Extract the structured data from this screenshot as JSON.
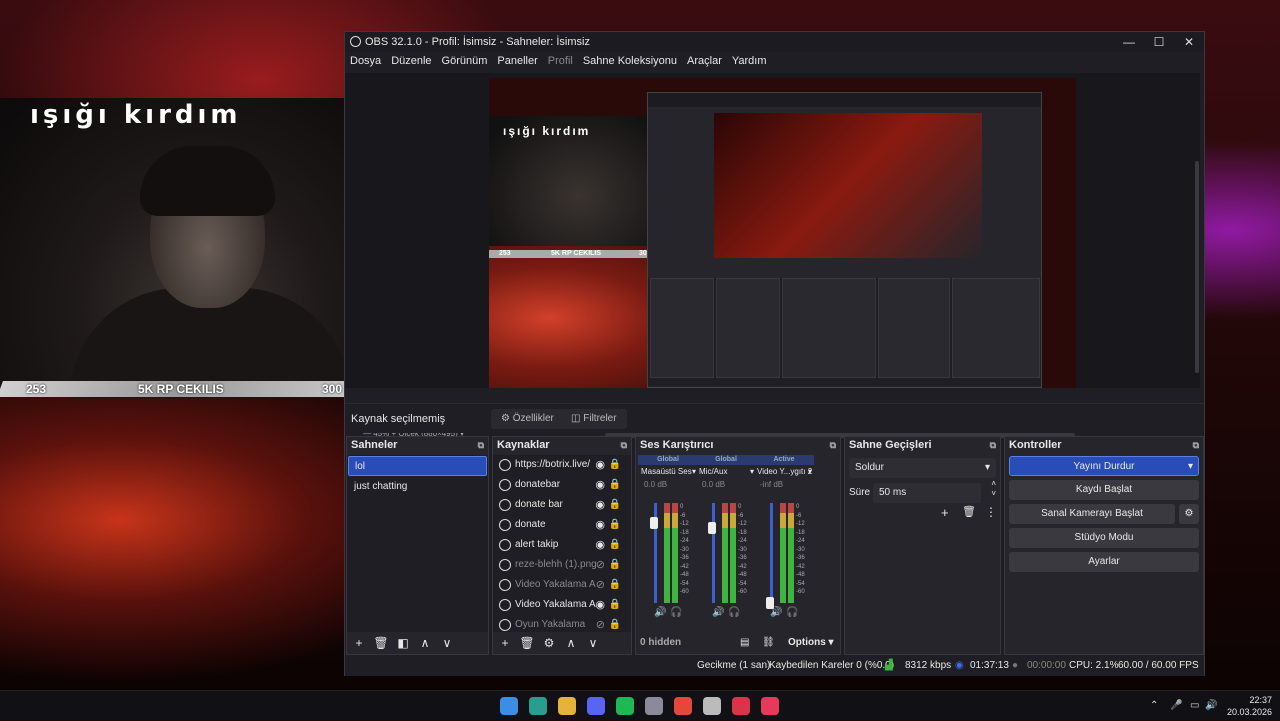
{
  "overlay": {
    "title": "ışığı kırdım",
    "bar_left": "253",
    "bar_mid": "5K RP CEKILIS",
    "bar_right": "300"
  },
  "window": {
    "title": "OBS 32.1.0 - Profil: İsimsiz - Sahneler: İsimsiz",
    "minimize": "—",
    "maximize": "☐",
    "close": "✕"
  },
  "menu": [
    "Dosya",
    "Düzenle",
    "Görünüm",
    "Paneller",
    "Profil",
    "Sahne Koleksiyonu",
    "Araçlar",
    "Yardım"
  ],
  "preview": {
    "zoom": "45%",
    "scale": "Ölçek (880×495)",
    "mini_title": "ışığı kırdım",
    "mini_bar_left": "253",
    "mini_bar_mid": "5K RP CEKILIS",
    "mini_bar_right": "300"
  },
  "source_bar": {
    "selected": "Kaynak seçilmemiş",
    "properties": "Özellikler",
    "filters": "Filtreler"
  },
  "scenes": {
    "title": "Sahneler",
    "items": [
      "lol",
      "just chatting"
    ]
  },
  "sources": {
    "title": "Kaynaklar",
    "items": [
      {
        "name": "https://botrix.live/",
        "dim": false
      },
      {
        "name": "donatebar",
        "dim": false
      },
      {
        "name": "donate bar",
        "dim": false
      },
      {
        "name": "donate",
        "dim": false
      },
      {
        "name": "alert takip",
        "dim": false
      },
      {
        "name": "reze-blehh (1).png",
        "dim": true
      },
      {
        "name": "Video Yakalama A",
        "dim": true
      },
      {
        "name": "Video Yakalama A",
        "dim": false
      },
      {
        "name": "Oyun Yakalama",
        "dim": true
      }
    ]
  },
  "mixer": {
    "title": "Ses Karıştırıcı",
    "channels": [
      {
        "header": "Global",
        "name": "Masaüstü Ses",
        "db": "0.0 dB",
        "level": 0.8
      },
      {
        "header": "Global",
        "name": "Mic/Aux",
        "db": "0.0 dB",
        "level": 0.75
      },
      {
        "header": "Active",
        "name": "Video Y...ygıtı 2",
        "db": "-inf dB",
        "level": 0.0
      }
    ],
    "ticks": [
      "0",
      "-6",
      "-12",
      "-18",
      "-24",
      "-30",
      "-36",
      "-42",
      "-48",
      "-54",
      "-60"
    ],
    "hidden": "0 hidden",
    "options": "Options"
  },
  "transitions": {
    "title": "Sahne Geçişleri",
    "type": "Soldur",
    "duration_label": "Süre",
    "duration": "50 ms"
  },
  "controls": {
    "title": "Kontroller",
    "stop_stream": "Yayını Durdur",
    "start_record": "Kaydı Başlat",
    "virtual_cam": "Sanal Kamerayı Başlat",
    "studio": "Stüdyo Modu",
    "settings": "Ayarlar"
  },
  "status": {
    "delay": "Gecikme (1 san)",
    "dropped": "Kaybedilen Kareler 0 (%0.0)",
    "bitrate": "8312 kbps",
    "stream_time": "01:37:13",
    "record_time": "00:00:00",
    "cpu": "CPU: 2.1%",
    "fps": "60.00 / 60.00 FPS"
  },
  "taskbar": {
    "time": "22:37",
    "date": "20.03.2026",
    "colors": [
      "#3a8ee6",
      "#2a9d8f",
      "#e6b33a",
      "#5865f2",
      "#1db954",
      "#8a8a9a",
      "#e5483a",
      "#bbbbbb",
      "#d9344a",
      "#e53a5a"
    ]
  }
}
